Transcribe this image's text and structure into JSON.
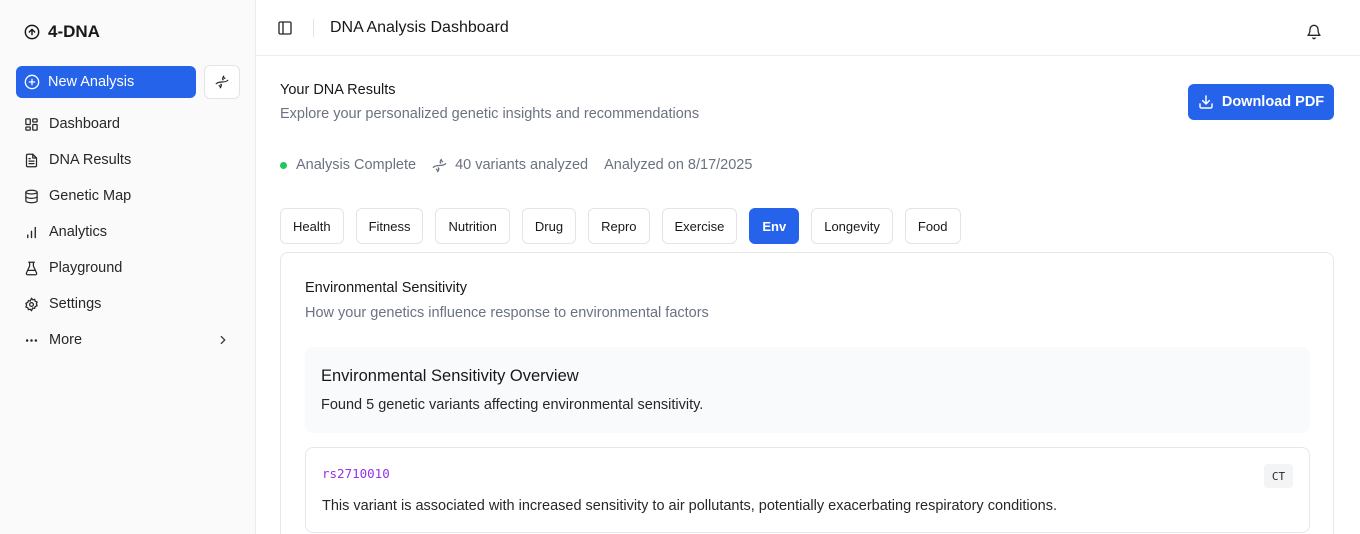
{
  "app": {
    "name": "4-DNA"
  },
  "sidebar": {
    "new_analysis_label": "New Analysis",
    "items": [
      {
        "label": "Dashboard",
        "icon": "dashboard-icon"
      },
      {
        "label": "DNA Results",
        "icon": "document-icon"
      },
      {
        "label": "Genetic Map",
        "icon": "database-icon"
      },
      {
        "label": "Analytics",
        "icon": "bar-chart-icon"
      },
      {
        "label": "Playground",
        "icon": "flask-icon"
      },
      {
        "label": "Settings",
        "icon": "gear-icon"
      },
      {
        "label": "More",
        "icon": "ellipsis-icon"
      }
    ]
  },
  "header": {
    "title": "DNA Analysis Dashboard"
  },
  "results": {
    "title": "Your DNA Results",
    "subtitle": "Explore your personalized genetic insights and recommendations",
    "download_label": "Download PDF",
    "status": "Analysis Complete",
    "variants_analyzed": "40 variants analyzed",
    "analyzed_on": "Analyzed on 8/17/2025"
  },
  "tabs": [
    {
      "label": "Health",
      "active": false
    },
    {
      "label": "Fitness",
      "active": false
    },
    {
      "label": "Nutrition",
      "active": false
    },
    {
      "label": "Drug",
      "active": false
    },
    {
      "label": "Repro",
      "active": false
    },
    {
      "label": "Exercise",
      "active": false
    },
    {
      "label": "Env",
      "active": true
    },
    {
      "label": "Longevity",
      "active": false
    },
    {
      "label": "Food",
      "active": false
    }
  ],
  "card": {
    "title": "Environmental Sensitivity",
    "subtitle": "How your genetics influence response to environmental factors",
    "overview_title": "Environmental Sensitivity Overview",
    "overview_text": "Found 5 genetic variants affecting environmental sensitivity.",
    "variants": [
      {
        "rsid": "rs2710010",
        "genotype": "CT",
        "description": "This variant is associated with increased sensitivity to air pollutants, potentially exacerbating respiratory conditions."
      }
    ]
  },
  "colors": {
    "primary": "#2563eb",
    "status_ok": "#22c55e",
    "rsid": "#9333ea"
  }
}
